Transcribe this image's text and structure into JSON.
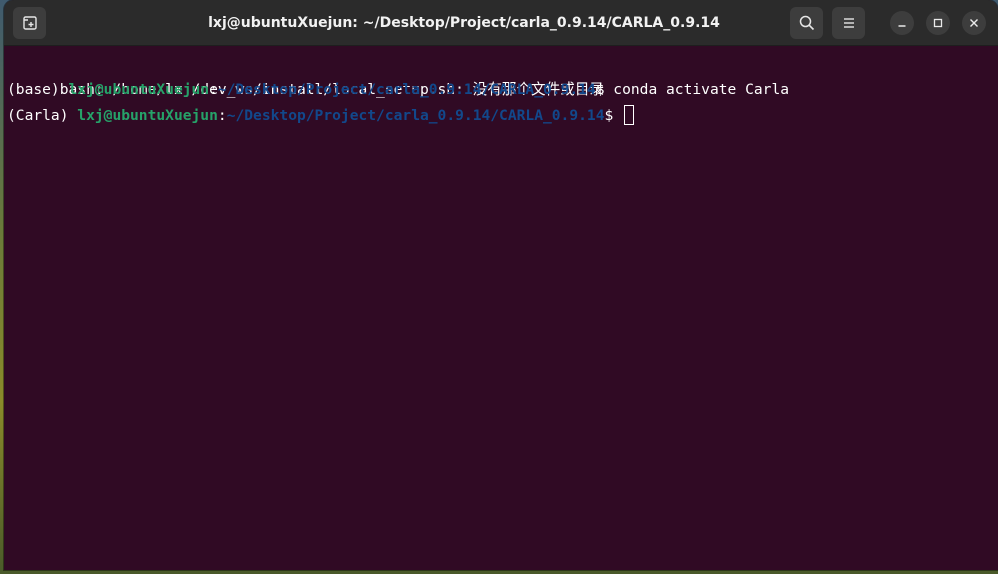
{
  "window": {
    "title": "lxj@ubuntuXuejun: ~/Desktop/Project/carla_0.9.14/CARLA_0.9.14",
    "icons": {
      "new_tab": "new-tab-icon",
      "search": "search-icon",
      "menu": "hamburger-menu-icon",
      "minimize": "minimize-icon",
      "maximize": "maximize-icon",
      "close": "close-icon"
    }
  },
  "terminal": {
    "colors": {
      "background": "#300a24",
      "user": "#26a269",
      "path": "#12488b",
      "text": "#ffffff"
    },
    "lines": [
      {
        "text": "bash: /home/lxj/dev_ws/install/local_setup.sh: 没有那个文件或目录"
      },
      {
        "env": "(base) ",
        "user": "lxj@ubuntuXuejun",
        "sep": ":",
        "path": "~/Desktop/Project/carla_0.9.14/CARLA_0.9.14",
        "prompt": "$ ",
        "command": "conda activate Carla"
      },
      {
        "env": "(Carla) ",
        "user": "lxj@ubuntuXuejun",
        "sep": ":",
        "path": "~/Desktop/Project/carla_0.9.14/CARLA_0.9.14",
        "prompt": "$ ",
        "command": ""
      }
    ]
  }
}
